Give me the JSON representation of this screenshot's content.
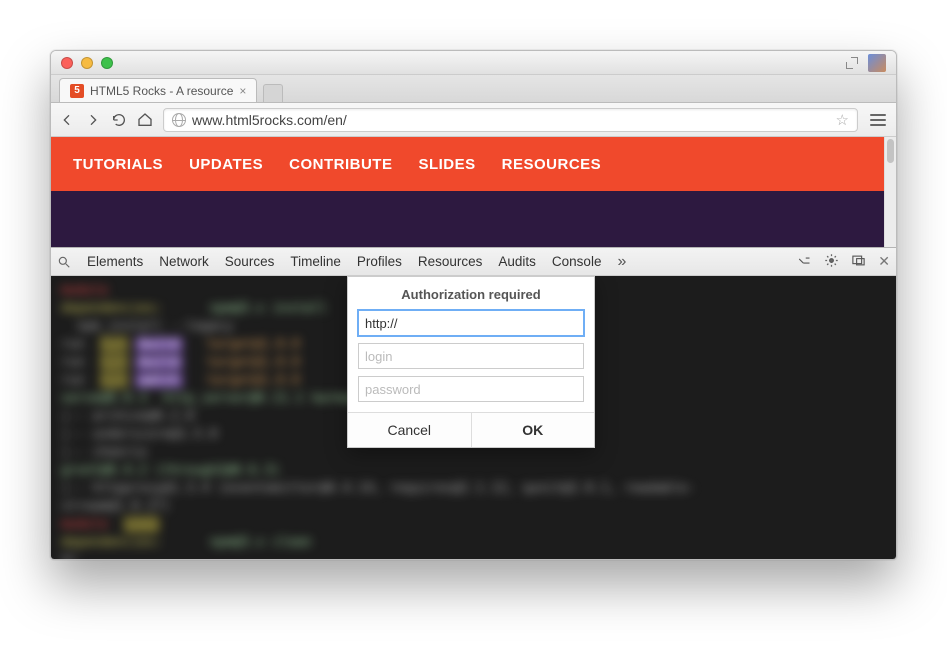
{
  "tab": {
    "title": "HTML5 Rocks - A resource",
    "favicon_letter": "5"
  },
  "address": {
    "url": "www.html5rocks.com/en/"
  },
  "site_nav": [
    "TUTORIALS",
    "UPDATES",
    "CONTRIBUTE",
    "SLIDES",
    "RESOURCES"
  ],
  "devtools": {
    "tabs": [
      "Elements",
      "Network",
      "Sources",
      "Timeline",
      "Profiles",
      "Resources",
      "Audits",
      "Console"
    ]
  },
  "dialog": {
    "title": "Authorization required",
    "url_value": "http://",
    "login_placeholder": "login",
    "password_placeholder": "password",
    "cancel": "Cancel",
    "ok": "OK"
  }
}
